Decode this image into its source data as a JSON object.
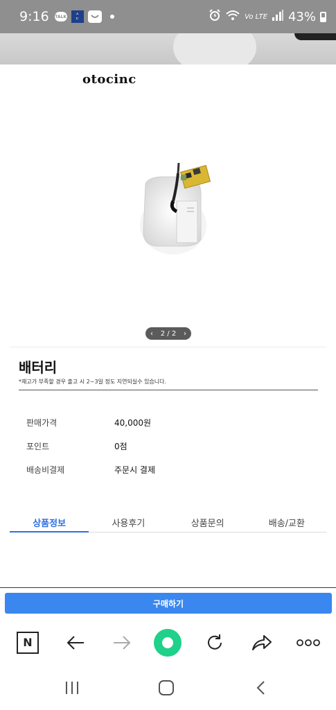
{
  "status_bar": {
    "time": "9:16",
    "notification_icons": [
      "talk-icon",
      "news-icon",
      "shopping-icon"
    ],
    "battery": "43%",
    "status_icons": [
      "alarm-icon",
      "wifi-icon",
      "lte-icon",
      "signal-icon",
      "battery-icon"
    ]
  },
  "product": {
    "brand_text": "otocinc",
    "pager": {
      "prev": "‹",
      "count": "2 / 2",
      "next": "›"
    },
    "title": "배터리",
    "notice": "*재고가 부족할 경우 출고 시 2~3일 정도 지연되실수 있습니다.",
    "info": [
      {
        "label": "판매가격",
        "value": "40,000원"
      },
      {
        "label": "포인트",
        "value": "0점"
      },
      {
        "label": "배송비결제",
        "value": "주문시 결제"
      }
    ]
  },
  "tabs": [
    {
      "label": "상품정보",
      "active": true
    },
    {
      "label": "사용후기",
      "active": false
    },
    {
      "label": "상품문의",
      "active": false
    },
    {
      "label": "배송/교환",
      "active": false
    }
  ],
  "buy_button": {
    "label": "구매하기",
    "color": "#3a87ef"
  },
  "browser_toolbar": {
    "n_label": "N",
    "icons": [
      "naver-n-icon",
      "back-arrow-icon",
      "forward-arrow-icon",
      "green-home-icon",
      "refresh-icon",
      "share-icon",
      "more-icon"
    ],
    "home_color": "#1fd18a"
  },
  "nav_bar": {
    "icons": [
      "recent-apps-icon",
      "home-icon",
      "back-icon"
    ]
  },
  "colors": {
    "accent": "#2f6fe0",
    "status_bar": "#8f8f8f"
  }
}
